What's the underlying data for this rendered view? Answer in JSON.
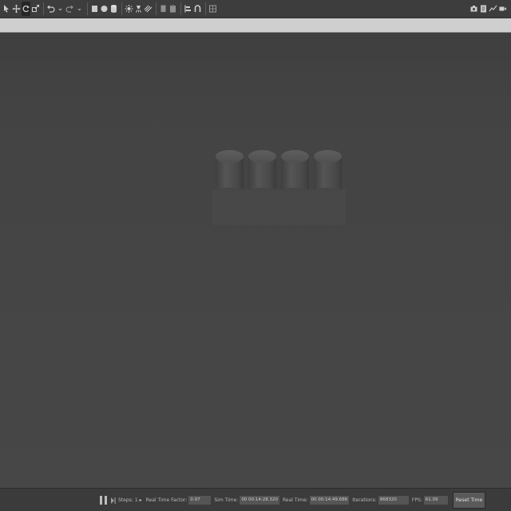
{
  "toolbar": {
    "left_tools": [
      {
        "icon": "select-arrow-icon"
      },
      {
        "icon": "translate-icon"
      },
      {
        "icon": "rotate-icon",
        "active": true
      },
      {
        "icon": "scale-icon"
      },
      {
        "icon": "sep"
      },
      {
        "icon": "undo-icon"
      },
      {
        "icon": "undo-dropdown-icon"
      },
      {
        "icon": "redo-icon"
      },
      {
        "icon": "redo-dropdown-icon"
      },
      {
        "icon": "sep"
      },
      {
        "icon": "box-shape-icon"
      },
      {
        "icon": "sphere-shape-icon"
      },
      {
        "icon": "cylinder-shape-icon"
      },
      {
        "icon": "sep"
      },
      {
        "icon": "point-light-icon"
      },
      {
        "icon": "spot-light-icon"
      },
      {
        "icon": "directional-light-icon"
      },
      {
        "icon": "sep"
      },
      {
        "icon": "copy-icon"
      },
      {
        "icon": "paste-icon"
      },
      {
        "icon": "sep"
      },
      {
        "icon": "align-icon"
      },
      {
        "icon": "snap-icon"
      },
      {
        "icon": "sep"
      },
      {
        "icon": "change-view-icon"
      }
    ],
    "right_tools": [
      {
        "icon": "screenshot-icon"
      },
      {
        "icon": "log-icon"
      },
      {
        "icon": "plot-icon"
      },
      {
        "icon": "record-video-icon"
      }
    ]
  },
  "status": {
    "steps_label": "Steps:",
    "steps_value": "1",
    "real_time_factor_label": "Real Time Factor:",
    "real_time_factor_value": "0.97",
    "sim_time_label": "Sim Time:",
    "sim_time_value": "00 00:14:28.320",
    "real_time_label": "Real Time:",
    "real_time_value": "00 00:14:49.686",
    "iterations_label": "Iterations:",
    "iterations_value": "868320",
    "fps_label": "FPS:",
    "fps_value": "61.09",
    "reset_label": "Reset Time"
  },
  "colors": {
    "background": "#454545",
    "toolbar": "#3d3d3d",
    "strip": "#cfcfcf",
    "model": "#4b4b4b"
  }
}
